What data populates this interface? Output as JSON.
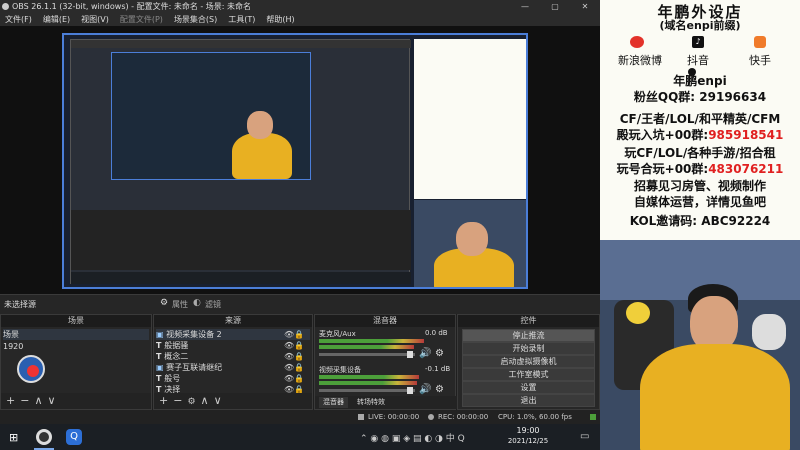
{
  "window": {
    "title": "OBS 26.1.1 (32-bit, windows) - 配置文件: 未命名 - 场景: 未命名",
    "controls": [
      "—",
      "▢",
      "✕"
    ]
  },
  "menu": [
    "文件(F)",
    "编辑(E)",
    "视图(V)",
    "配置文件(P)",
    "场景集合(S)",
    "工具(T)",
    "帮助(H)"
  ],
  "source_toolbar": {
    "status": "未选择源",
    "properties": "属性",
    "filters": "滤镜"
  },
  "docks": {
    "scenes": {
      "title": "场景",
      "items": [
        "场景",
        "1920"
      ]
    },
    "sources": {
      "title": "来源",
      "items": [
        "视频采集设备 2",
        "般据骚",
        "概念二",
        "赛子互联请继纪",
        "般号",
        "决择"
      ]
    },
    "mixer": {
      "title": "混音器",
      "channels": [
        {
          "name": "麦克风/Aux",
          "db": "0.0 dB"
        },
        {
          "name": "视频采集设备",
          "db": "-0.1 dB"
        }
      ],
      "tabs": [
        "混音器",
        "转场特效"
      ]
    },
    "controls": {
      "title": "控件",
      "buttons": [
        "停止推流",
        "开始录制",
        "启动虚拟摄像机",
        "工作室模式",
        "设置",
        "退出"
      ]
    }
  },
  "statusbar": {
    "live": "LIVE: 00:00:00",
    "rec": "REC: 00:00:00",
    "cpu": "CPU: 1.0%, 60.00 fps"
  },
  "taskbar": {
    "time": "19:00",
    "date": "2021/12/25"
  },
  "promo": {
    "title": "年鹏外设店",
    "subtitle": "(域名enpi前缀)",
    "socials": [
      "新浪微博",
      "抖音",
      "快手"
    ],
    "name": "年鹏enpi",
    "fans_group": "粉丝QQ群: 29196634",
    "line1": "CF/王者/LOL/和平精英/CFM",
    "line2_prefix": "殿玩入坑+00群:",
    "line2_num": "985918541",
    "line3": "玩CF/LOL/各种手游/招合租",
    "line4_prefix": "玩号合玩+00群:",
    "line4_num": "483076211",
    "line5": "招募见习房管、视频制作",
    "line6": "自媒体运营，详情见鱼吧",
    "kol": "KOL邀请码: ABC92224"
  },
  "colors": {
    "accent": "#4b7ed8",
    "promo_red": "#e02020",
    "hoodie": "#e8b022"
  }
}
